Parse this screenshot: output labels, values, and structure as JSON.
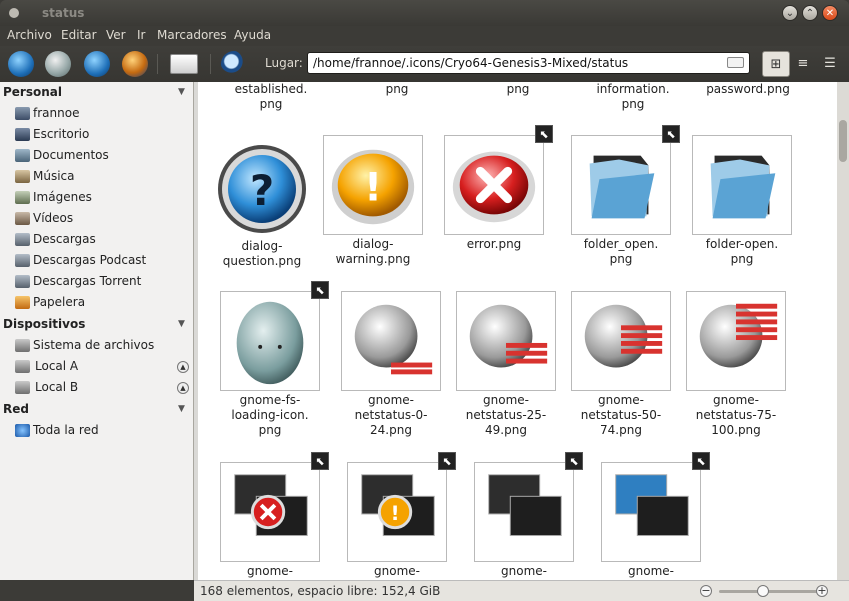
{
  "window": {
    "title": "status"
  },
  "menubar": [
    "Archivo",
    "Editar",
    "Ver",
    "Ir",
    "Marcadores",
    "Ayuda"
  ],
  "toolbar": {
    "location_label": "Lugar:",
    "location_value": "/home/frannoe/.icons/Cryo64-Genesis3-Mixed/status"
  },
  "sidebar": {
    "sections": [
      {
        "title": "Personal",
        "items": [
          "frannoe",
          "Escritorio",
          "Documentos",
          "Música",
          "Imágenes",
          "Vídeos",
          "Descargas",
          "Descargas Podcast",
          "Descargas Torrent",
          "Papelera"
        ]
      },
      {
        "title": "Dispositivos",
        "items": [
          "Sistema de archivos",
          "Local A",
          "Local B"
        ]
      },
      {
        "title": "Red",
        "items": [
          "Toda la red"
        ]
      }
    ]
  },
  "files": {
    "partial_top": [
      "established.\npng",
      "png",
      "png",
      "information.\npng",
      "password.png"
    ],
    "row1": [
      "dialog-\nquestion.png",
      "dialog-\nwarning.png",
      "error.png",
      "folder_open.\npng",
      "folder-open.\npng"
    ],
    "row2": [
      "gnome-fs-\nloading-icon.\npng",
      "gnome-\nnetstatus-0-\n24.png",
      "gnome-\nnetstatus-25-\n49.png",
      "gnome-\nnetstatus-50-\n74.png",
      "gnome-\nnetstatus-75-\n100.png"
    ],
    "row3": [
      "gnome-",
      "gnome-",
      "gnome-",
      "gnome-"
    ]
  },
  "statusbar": {
    "text": "168 elementos, espacio libre: 152,4 GiB"
  },
  "icons": {
    "link_badge": "symlink-arrow-icon",
    "chevron": "chevron-down-icon",
    "eject": "eject-icon"
  }
}
